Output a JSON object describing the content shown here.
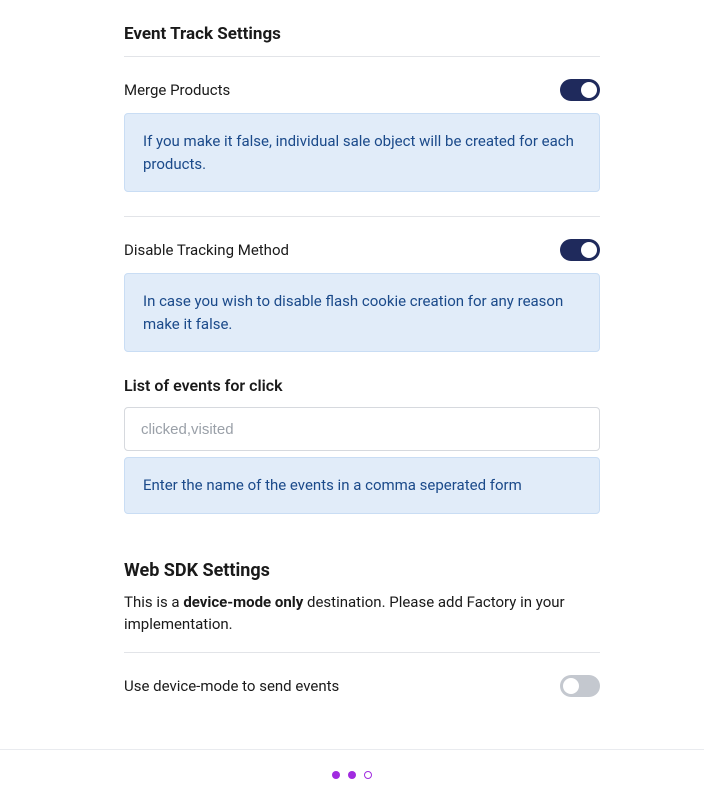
{
  "section1": {
    "title": "Event Track Settings",
    "merge": {
      "label": "Merge Products",
      "info": "If you make it false, individual sale object will be created for each products."
    },
    "disable": {
      "label": "Disable Tracking Method",
      "info": "In case you wish to disable flash cookie creation for any reason make it false."
    },
    "events": {
      "label": "List of events for click",
      "placeholder": "clicked,visited",
      "info": "Enter the name of the events in a comma seperated form"
    }
  },
  "section2": {
    "title": "Web SDK Settings",
    "desc_prefix": "This is a ",
    "desc_bold": "device-mode only",
    "desc_suffix": " destination. Please add Factory in your implementation.",
    "device_mode": {
      "label": "Use device-mode to send events"
    }
  },
  "toggles": {
    "merge_products": true,
    "disable_tracking": true,
    "device_mode": false
  },
  "colors": {
    "accent": "#a12be0",
    "toggle_on": "#1f2a5c",
    "toggle_off": "#c4c8cf",
    "info_bg": "#e1ecf9",
    "info_text": "#1b4a8a"
  },
  "pagination": {
    "total": 3,
    "current": 2
  }
}
